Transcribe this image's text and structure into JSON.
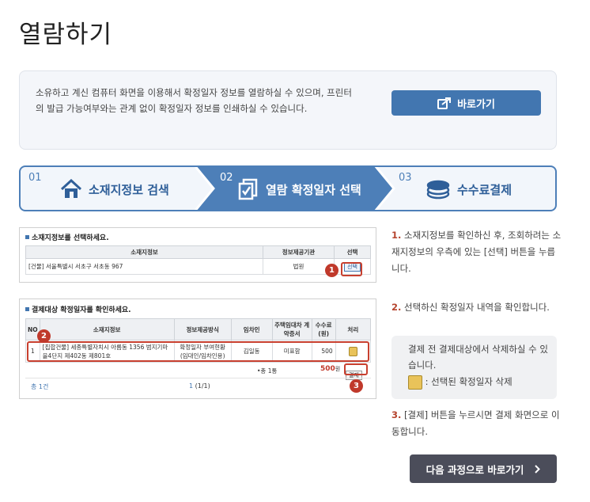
{
  "page": {
    "title": "열람하기"
  },
  "info": {
    "text": "소유하고 계신 컴퓨터 화면을 이용해서 확정일자 정보를 열람하실 수 있으며, 프린터의 발급 가능여부와는 관계 없이 확정일자 정보를 인쇄하실 수 있습니다.",
    "button_label": "바로가기",
    "button_icon": "external-link-icon"
  },
  "steps": [
    {
      "num": "01",
      "label": "소재지정보 검색",
      "icon": "house-icon",
      "active": false
    },
    {
      "num": "02",
      "label": "열람 확정일자 선택",
      "icon": "documents-icon",
      "active": true
    },
    {
      "num": "03",
      "label": "수수료결제",
      "icon": "coins-icon",
      "active": false
    }
  ],
  "shot1": {
    "title": "소재지정보를 선택하세요.",
    "headers": [
      "소재지정보",
      "정보제공기관",
      "선택"
    ],
    "row": {
      "address": "[건물] 서울특별시 서초구 서초동 967",
      "agency": "법원",
      "select": "선택"
    },
    "badge": "1"
  },
  "shot2": {
    "title": "결제대상 확정일자를 확인하세요.",
    "headers": [
      "NO",
      "소재지정보",
      "정보제공방식",
      "임차인",
      "주택임대차 계약증서",
      "수수료 (원)",
      "처리"
    ],
    "row": {
      "no": "1",
      "address": "[집합건물] 세종특별자치시 아름동 1356 범지기마을4단지 제402동 제801호",
      "method": "확정일자 부여현황 (임대인/임차인용)",
      "tenant": "김일동",
      "contract": "미표함",
      "fee": "500"
    },
    "total_count": "•총 1통",
    "total_fee": "500",
    "total_fee_unit": "원",
    "pay_label": "결제",
    "paging_count": "총 1건",
    "paging_page": "1",
    "paging_of": "(1/1)",
    "badge2": "2",
    "badge3": "3"
  },
  "instructions": {
    "i1_num": "1.",
    "i1_text": "소재지정보를 확인하신 후, 조회하려는 소재지정보의 우측에 있는 [선택] 버튼을 누릅니다.",
    "i2_num": "2.",
    "i2_text": "선택하신 확정일자 내역을 확인합니다.",
    "note_text": "결제 전 결제대상에서 삭제하실 수 있습니다.",
    "note_icon_text": ": 선택된 확정일자 삭제",
    "i3_num": "3.",
    "i3_text": "[결제] 버튼을 누르시면 결제 화면으로 이동합니다."
  },
  "next": {
    "label": "다음 과정으로 바로가기",
    "icon": "chevron-right-icon"
  },
  "colors": {
    "primary": "#4276b0",
    "step_active": "#4d7fb8",
    "accent_red": "#c0392b",
    "dark_button": "#4b4d5a"
  }
}
